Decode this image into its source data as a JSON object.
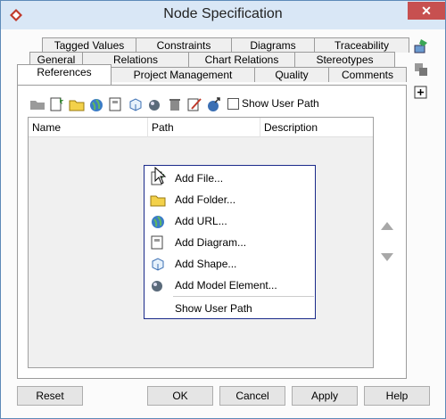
{
  "window": {
    "title": "Node Specification",
    "close_glyph": "✕"
  },
  "tabs": {
    "row1": [
      "Tagged Values",
      "Constraints",
      "Diagrams",
      "Traceability"
    ],
    "row2": [
      "General",
      "Relations",
      "Chart Relations",
      "Stereotypes"
    ],
    "row3": [
      "References",
      "Project Management",
      "Quality",
      "Comments"
    ]
  },
  "toolbar": {
    "show_user_path_label": "Show User Path",
    "show_user_path_checked": false
  },
  "table": {
    "columns": [
      "Name",
      "Path",
      "Description"
    ]
  },
  "context_menu": {
    "items": [
      "Add File...",
      "Add Folder...",
      "Add URL...",
      "Add Diagram...",
      "Add Shape...",
      "Add Model Element...",
      "Show User Path"
    ]
  },
  "buttons": {
    "reset": "Reset",
    "ok": "OK",
    "cancel": "Cancel",
    "apply": "Apply",
    "help": "Help"
  },
  "colors": {
    "title_bar": "#d9e7f6",
    "close_button": "#c75050",
    "menu_border": "#1a2a8a"
  }
}
